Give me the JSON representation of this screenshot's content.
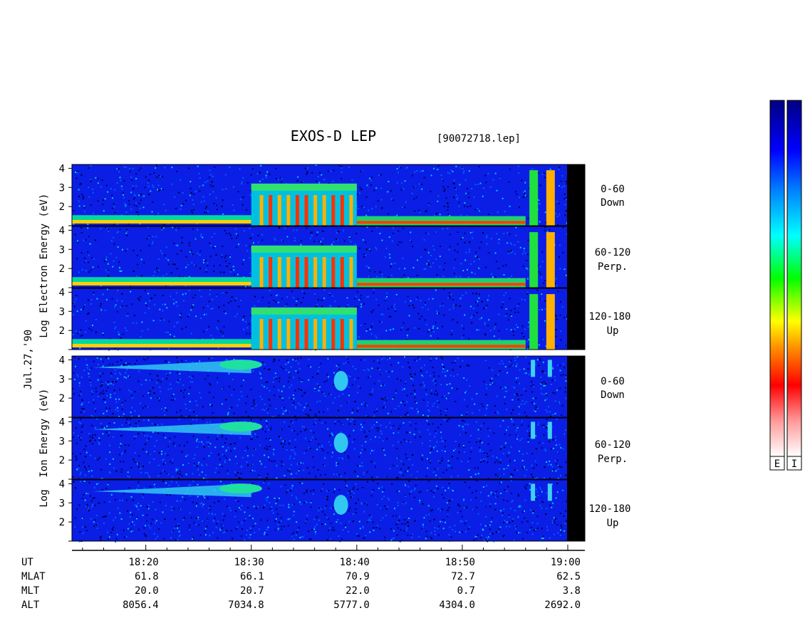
{
  "title": "EXOS-D LEP",
  "file_label": "[90072718.lep]",
  "date_label": "Jul.27,'90",
  "electron_group": {
    "ylabel": [
      "Log",
      "Electron",
      "Energy (eV)"
    ],
    "panels": [
      {
        "angle": "0-60",
        "direction": "Down"
      },
      {
        "angle": "60-120",
        "direction": "Perp."
      },
      {
        "angle": "120-180",
        "direction": "Up"
      }
    ]
  },
  "ion_group": {
    "ylabel": [
      "Log",
      "Ion",
      "Energy (eV)"
    ],
    "panels": [
      {
        "angle": "0-60",
        "direction": "Down"
      },
      {
        "angle": "60-120",
        "direction": "Perp."
      },
      {
        "angle": "120-180",
        "direction": "Up"
      }
    ]
  },
  "colorbar_labels": [
    "E",
    "I"
  ],
  "colorbar_colors": [
    "#ffffff",
    "#ff0000",
    "#ff8800",
    "#ffff00",
    "#00ff00",
    "#00ffff",
    "#0088ff",
    "#0000ff",
    "#000080"
  ],
  "chart_data": {
    "type": "heatmap",
    "x_range_minutes": [
      "18:13",
      "19:00"
    ],
    "yticks": [
      1,
      2,
      3,
      4
    ],
    "ylim": [
      1,
      4.2
    ],
    "orbit_table": {
      "row_labels": [
        "UT",
        "MLAT",
        "MLT",
        "ALT"
      ],
      "columns": [
        {
          "UT": "18:20",
          "MLAT": "61.8",
          "MLT": "20.0",
          "ALT": "8056.4"
        },
        {
          "UT": "18:30",
          "MLAT": "66.1",
          "MLT": "20.7",
          "ALT": "7034.8"
        },
        {
          "UT": "18:40",
          "MLAT": "70.9",
          "MLT": "22.0",
          "ALT": "5777.0"
        },
        {
          "UT": "18:50",
          "MLAT": "72.7",
          "MLT": "0.7",
          "ALT": "4304.0"
        },
        {
          "UT": "19:00",
          "MLAT": "62.5",
          "MLT": "3.8",
          "ALT": "2692.0"
        }
      ]
    }
  }
}
